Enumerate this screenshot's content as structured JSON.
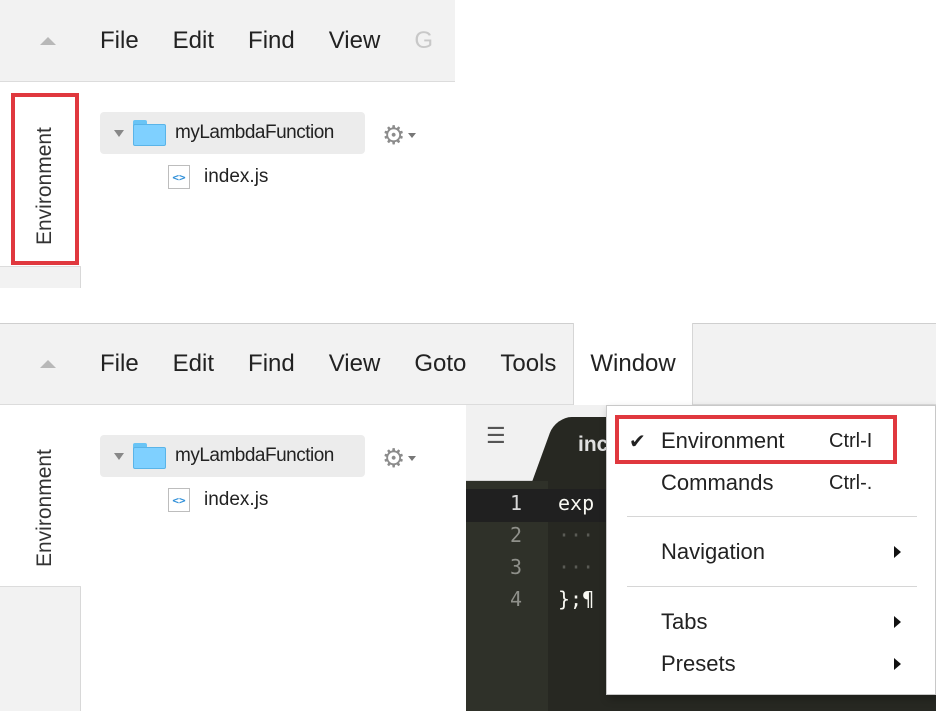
{
  "colors": {
    "highlight": "#e0383e",
    "folder": "#7fd0ff",
    "editor_bg": "#272822",
    "menubar_bg": "#f2f2f2"
  },
  "top_panel": {
    "menubar": {
      "collapse_icon": "triangle-up-icon",
      "items": [
        "File",
        "Edit",
        "Find",
        "View",
        "G"
      ]
    },
    "side_tab": "Environment",
    "tree": {
      "root_label": "myLambdaFunction",
      "root_icon": "folder-icon",
      "settings_icon": "gear-icon",
      "file_label": "index.js",
      "file_icon": "js-file-icon",
      "file_icon_glyph": "<>"
    }
  },
  "bottom_panel": {
    "menubar": {
      "collapse_icon": "triangle-up-icon",
      "items": [
        "File",
        "Edit",
        "Find",
        "View",
        "Goto",
        "Tools"
      ],
      "active_item": "Window"
    },
    "side_tab": "Environment",
    "tree": {
      "root_label": "myLambdaFunction",
      "file_label": "index.js",
      "file_icon_glyph": "<>"
    },
    "editor": {
      "tab_list_icon_glyph": "☰",
      "tab_label": "inc",
      "line_numbers": [
        "1",
        "2",
        "3",
        "4"
      ],
      "code_lines": [
        "exp",
        "···",
        "···",
        "};¶"
      ]
    },
    "window_menu": {
      "items": [
        {
          "label": "Environment",
          "shortcut": "Ctrl-I",
          "checked": true,
          "check_glyph": "✔",
          "submenu": false
        },
        {
          "label": "Commands",
          "shortcut": "Ctrl-.",
          "checked": false,
          "submenu": false
        },
        {
          "label": "Navigation",
          "shortcut": "",
          "checked": false,
          "submenu": true
        },
        {
          "label": "Tabs",
          "shortcut": "",
          "checked": false,
          "submenu": true
        },
        {
          "label": "Presets",
          "shortcut": "",
          "checked": false,
          "submenu": true
        }
      ]
    }
  }
}
